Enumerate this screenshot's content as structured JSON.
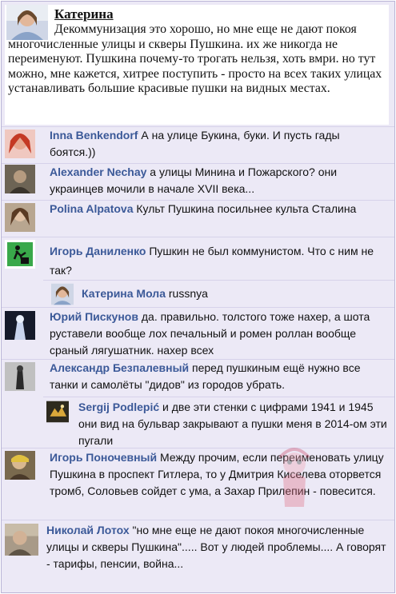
{
  "post": {
    "author": "Катерина",
    "text": "Декоммунизация это хорошо, но мне еще не дают покоя многочисленные улицы и скверы Пушкина. их же никогда не переименуют. Пушкина почему-то трогать нельзя, хоть вмри. но тут можно, мне кажется, хитрее поступить - просто на всех таких улицах устанавливать большие красивые пушки на видных местах."
  },
  "comments": [
    {
      "name": "Inna Benkendorf",
      "text": "А на улице Букина, буки. И пусть гады боятся.))"
    },
    {
      "name": "Alexander Nechay",
      "text": "а улицы Минина и Пожарского? они украинцев мочили в начале XVII века..."
    },
    {
      "name": "Polina Alpatova",
      "text": "Культ Пушкина посильнее культа Сталина"
    },
    {
      "name": "Игорь Даниленко",
      "text": "Пушкин не был коммунистом. Что с ним не так?"
    },
    {
      "name": "Катерина Мола",
      "text": "russnya"
    },
    {
      "name": "Юрий Пискунов",
      "text": "да. правильно. толстого тоже нахер, а шота руставели вообще лох печальный и ромен роллан вообще сраный лягушатник. нахер всех"
    },
    {
      "name": "Александр Безпалевный",
      "text": "перед пушкиным ещё нужно все танки и самолёты \"дидов\" из городов убрать."
    },
    {
      "name": "Sergij Podlepić",
      "text": "и две эти стенки с цифрами 1941 и 1945  они вид на бульвар закрывают а пушки меня в 2014-ом эти пугали"
    },
    {
      "name": "Игорь Поночевный",
      "text": "Между прочим, если переименовать улицу Пушкина в  проспект Гитлера, то у Дмитрия Киселева оторвется тромб, Соловьев сойдет с  ума, а Захар Прилепин - повесится."
    },
    {
      "name": "Николай Лотох",
      "text": "\"но мне еще не дают покоя многочисленные улицы и скверы Пушкина\"..... Вот у людей проблемы.... А говорят - тарифы, пенсии, война..."
    }
  ],
  "colors": {
    "name": "#3b5998",
    "background": "#ece9f6"
  }
}
